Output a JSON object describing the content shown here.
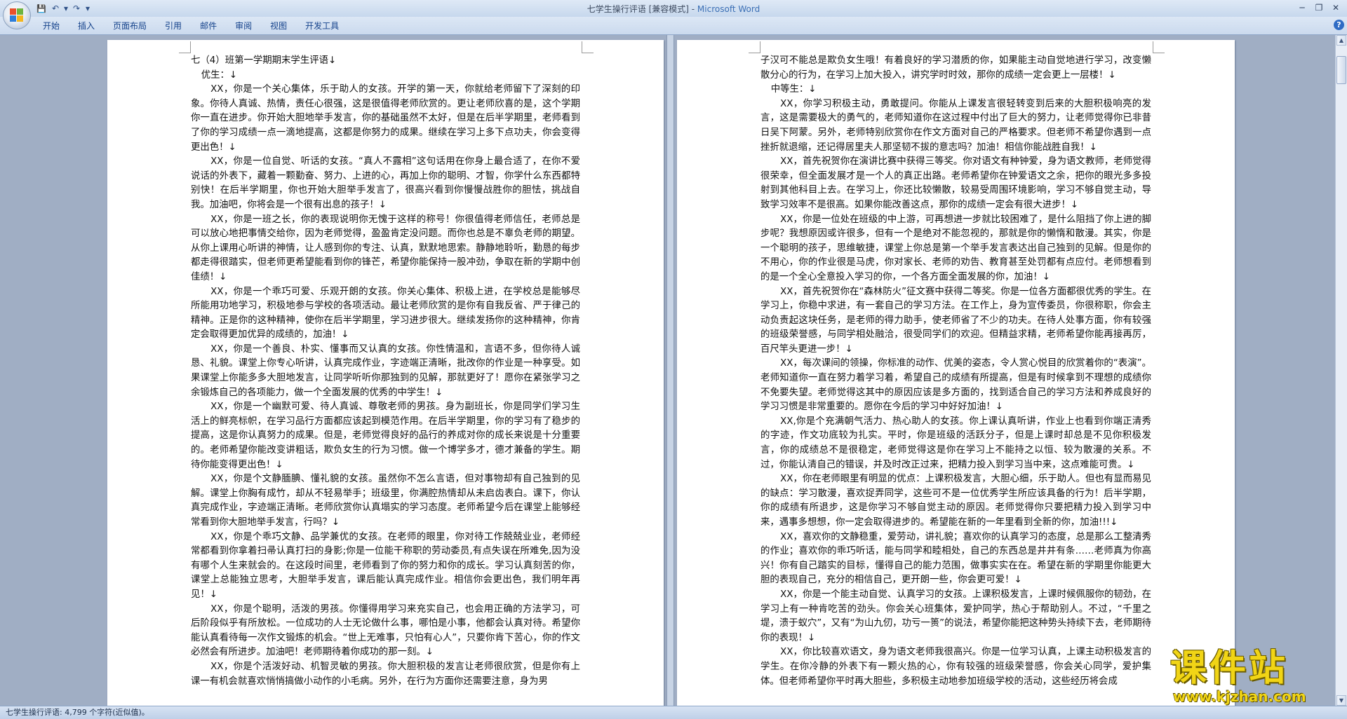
{
  "window": {
    "title": "七学生操行评语 [兼容模式] - ",
    "app_name": "Microsoft Word",
    "controls": [
      "─",
      "❐",
      "✕"
    ]
  },
  "qat": {
    "save": "💾",
    "undo": "↶",
    "undo_dd": "▾",
    "redo": "↷",
    "customize": "▾"
  },
  "ribbon": {
    "tabs": [
      "开始",
      "插入",
      "页面布局",
      "引用",
      "邮件",
      "审阅",
      "视图",
      "开发工具"
    ],
    "help": "?"
  },
  "page1": {
    "title": "七（4）班第一学期期末学生评语↓",
    "section": "优生：↓",
    "paragraphs": [
      "XX，你是一个关心集体，乐于助人的女孩。开学的第一天，你就给老师留下了深刻的印象。你待人真诚、热情，责任心很强，这是很值得老师欣赏的。更让老师欣喜的是，这个学期你一直在进步。你开始大胆地举手发言，你的基础虽然不太好，但是在后半学期里，老师看到了你的学习成绩一点一滴地提高，这都是你努力的成果。继续在学习上多下点功夫，你会变得更出色！↓",
      "XX，你是一位自觉、听话的女孩。“真人不露相”这句话用在你身上最合适了，在你不爱说话的外表下，藏着一颗勤奋、努力、上进的心，再加上你的聪明、才智，你学什么东西都特别快！在后半学期里，你也开始大胆举手发言了，很高兴看到你慢慢战胜你的胆怯，挑战自我。加油吧，你将会是一个很有出息的孩子！↓",
      "XX，你是一班之长，你的表现说明你无愧于这样的称号！你很值得老师信任，老师总是可以放心地把事情交给你，因为老师觉得，盈盈肯定没问题。而你也总是不辜负老师的期望。从你上课用心听讲的神情，让人感到你的专注、认真，默默地思索。静静地聆听，勤恳的每步都走得很踏实，但老师更希望能看到你的锋芒，希望你能保持一股冲劲，争取在新的学期中创佳绩！↓",
      "XX，你是一个乖巧可爱、乐观开朗的女孩。你关心集体、积极上进，在学校总是能够尽所能用功地学习，积极地参与学校的各项活动。最让老师欣赏的是你有自我反省、严于律己的精神。正是你的这种精神，使你在后半学期里，学习进步很大。继续发扬你的这种精神，你肯定会取得更加优异的成绩的，加油！↓",
      "XX，你是一个善良、朴实、懂事而又认真的女孩。你性情温和，言语不多，但你待人诚恳、礼貌。课堂上你专心听讲，认真完成作业，字迹端正清晰，批改你的作业是一种享受。如果课堂上你能多多大胆地发言，让同学听听你那独到的见解，那就更好了！愿你在紧张学习之余锻炼自己的各项能力，做一个全面发展的优秀的中学生！↓",
      "XX，你是一个幽默可爱、待人真诚、尊敬老师的男孩。身为副班长，你是同学们学习生活上的鲜亮标帜，在学习品行方面都应该起到模范作用。在后半学期里，你的学习有了稳步的提高，这是你认真努力的成果。但是，老师觉得良好的品行的养成对你的成长来说是十分重要的。老师希望你能改变讲粗话，欺负女生的行为习惯。做一个博学多才，德才兼备的学生。期待你能变得更出色！↓",
      "XX，你是个文静腼腆、懂礼貌的女孩。虽然你不怎么言语，但对事物却有自己独到的见解。课堂上你胸有成竹，却从不轻易举手；班级里，你满腔热情却从未启齿表白。课下，你认真完成作业，字迹端正清晰。老师欣赏你认真塌实的学习态度。老师希望今后在课堂上能够经常看到你大胆地举手发言，行吗？↓",
      "XX，你是个乖巧文静、品学兼优的女孩。在老师的眼里，你对待工作兢兢业业，老师经常都看到你拿着扫帚认真打扫的身影;你是一位能干称职的劳动委员,有点失误在所难免,因为没有哪个人生来就会的。在这段时间里，老师看到了你的努力和你的成长。学习认真刻苦的你，课堂上总能独立思考，大胆举手发言，课后能认真完成作业。相信你会更出色，我们明年再见！↓",
      "XX，你是个聪明，活泼的男孩。你懂得用学习来充实自己，也会用正确的方法学习，可后阶段似乎有所放松。一位成功的人士无论做什么事，哪怕是小事，他都会认真对待。希望你能认真看待每一次作文锻炼的机会。“世上无难事，只怕有心人”，只要你肯下苦心，你的作文必然会有所进步。加油吧！老师期待着你成功的那一刻。↓",
      "XX，你是个活泼好动、机智灵敏的男孩。你大胆积极的发言让老师很欣赏，但是你有上课一有机会就喜欢悄悄搞做小动作的小毛病。另外，在行为方面你还需要注意，身为男"
    ]
  },
  "page2": {
    "paragraphs_before": [
      "子汉可不能总是欺负女生哦！有着良好的学习潜质的你，如果能主动自觉地进行学习，改变懒散分心的行为，在学习上加大投入，讲究学时时效，那你的成绩一定会更上一层楼！↓"
    ],
    "section": "中等生：↓",
    "paragraphs": [
      "XX，你学习积极主动，勇敢提问。你能从上课发言很轻转变到后来的大胆积极响亮的发言，这是需要极大的勇气的，老师知道你在这过程中付出了巨大的努力，让老师觉得你已非昔日吴下阿蒙。另外，老师特别欣赏你在作文方面对自己的严格要求。但老师不希望你遇到一点挫折就退缩，还记得居里夫人那坚韧不拔的意志吗？加油！相信你能战胜自我！↓",
      "XX，首先祝贺你在演讲比赛中获得三等奖。你对语文有种钟爱，身为语文教师，老师觉得很荣幸，但全面发展才是一个人的真正出路。老师希望你在钟爱语文之余，把你的眼光多多投射到其他科目上去。在学习上，你还比较懒散，较易受周围环境影响，学习不够自觉主动，导致学习效率不是很高。如果你能改善这点，那你的成绩一定会有很大进步！↓",
      "XX，你是一位处在班级的中上游，可再想进一步就比较困难了，是什么阻挡了你上进的脚步呢？我想原因或许很多，但有一个是绝对不能忽视的，那就是你的懒惰和散漫。其实，你是一个聪明的孩子，思维敏捷，课堂上你总是第一个举手发言表达出自己独到的见解。但是你的不用心，你的作业很是马虎，你对家长、老师的劝告、教育甚至处罚都有点应付。老师想看到的是一个全心全意投入学习的你，一个各方面全面发展的你，加油！↓",
      "XX，首先祝贺你在“森林防火”征文赛中获得二等奖。你是一位各方面都很优秀的学生。在学习上，你稳中求进，有一套自己的学习方法。在工作上，身为宣传委员，你很称职，你会主动负责起这块任务，是老师的得力助手，使老师省了不少的功夫。在待人处事方面，你有较强的班级荣誉感，与同学相处融洽，很受同学们的欢迎。但精益求精，老师希望你能再接再厉，百尺竿头更进一步！↓",
      "XX，每次课间的领操，你标准的动作、优美的姿态，令人赏心悦目的欣赏着你的“表演”。老师知道你一直在努力着学习着，希望自己的成绩有所提高，但是有时候拿到不理想的成绩你不免要失望。老师觉得这其中的原因应该是多方面的，找到适合自己的学习方法和养成良好的学习习惯是非常重要的。愿你在今后的学习中好好加油！↓",
      "XX,你是个充满朝气活力、热心助人的女孩。你上课认真听讲，作业上也看到你端正清秀的字迹，作文功底较为扎实。平时，你是班级的活跃分子，但是上课时却总是不见你积极发言，你的成绩总不是很稳定，老师觉得这是你在学习上不能持之以恒、较为散漫的关系。不过，你能认清自己的错误，并及时改正过来，把精力投入到学习当中来，这点难能可贵。↓",
      "XX，你在老师眼里有明显的优点：上课积极发言，大胆心细，乐于助人。但也有显而易见的缺点：学习散漫，喜欢捉弄同学，这些可不是一位优秀学生所应该具备的行为！后半学期，你的成绩有所退步，这是你学习不够自觉主动的原因。老师觉得你只要把精力投入到学习中来，遇事多想想，你一定会取得进步的。希望能在新的一年里看到全新的你，加油!!!↓",
      "XX，喜欢你的文静稳重，爱劳动，讲礼貌；喜欢你的认真学习的态度，总是那么工整清秀的作业；喜欢你的乖巧听话，能与同学和睦相处，自己的东西总是井井有条……老师真为你高兴！你有自己踏实的目标，懂得自己的能力范围，做事实实在在。希望在新的学期里你能更大胆的表现自己，充分的相信自己，更开朗一些，你会更可爱！↓",
      "XX，你是一个能主动自觉、认真学习的女孩。上课积极发言，上课时候佩服你的韧劲，在学习上有一种肯吃苦的劲头。你会关心班集体，爱护同学，热心于帮助别人。不过，“千里之堤，溃于蚁穴”，又有“为山九仞，功亏一篑”的说法，希望你能把这种势头持续下去，老师期待你的表现！↓",
      "XX，你比较喜欢语文，身为语文老师我很高兴。你是一位学习认真，上课主动积极发言的学生。在你冷静的外表下有一颗火热的心，你有较强的班级荣誉感，你会关心同学，爱护集体。但老师希望你平时再大胆些，多积极主动地参加班级学校的活动，这些经历将会成"
    ]
  },
  "statusbar": {
    "text": "七学生操行评语: 4,799 个字符(近似值)。"
  },
  "scrollbar": {
    "up": "▲",
    "down": "▼"
  },
  "watermark": {
    "big": "课件站",
    "url": "www.kjzhan.com"
  }
}
